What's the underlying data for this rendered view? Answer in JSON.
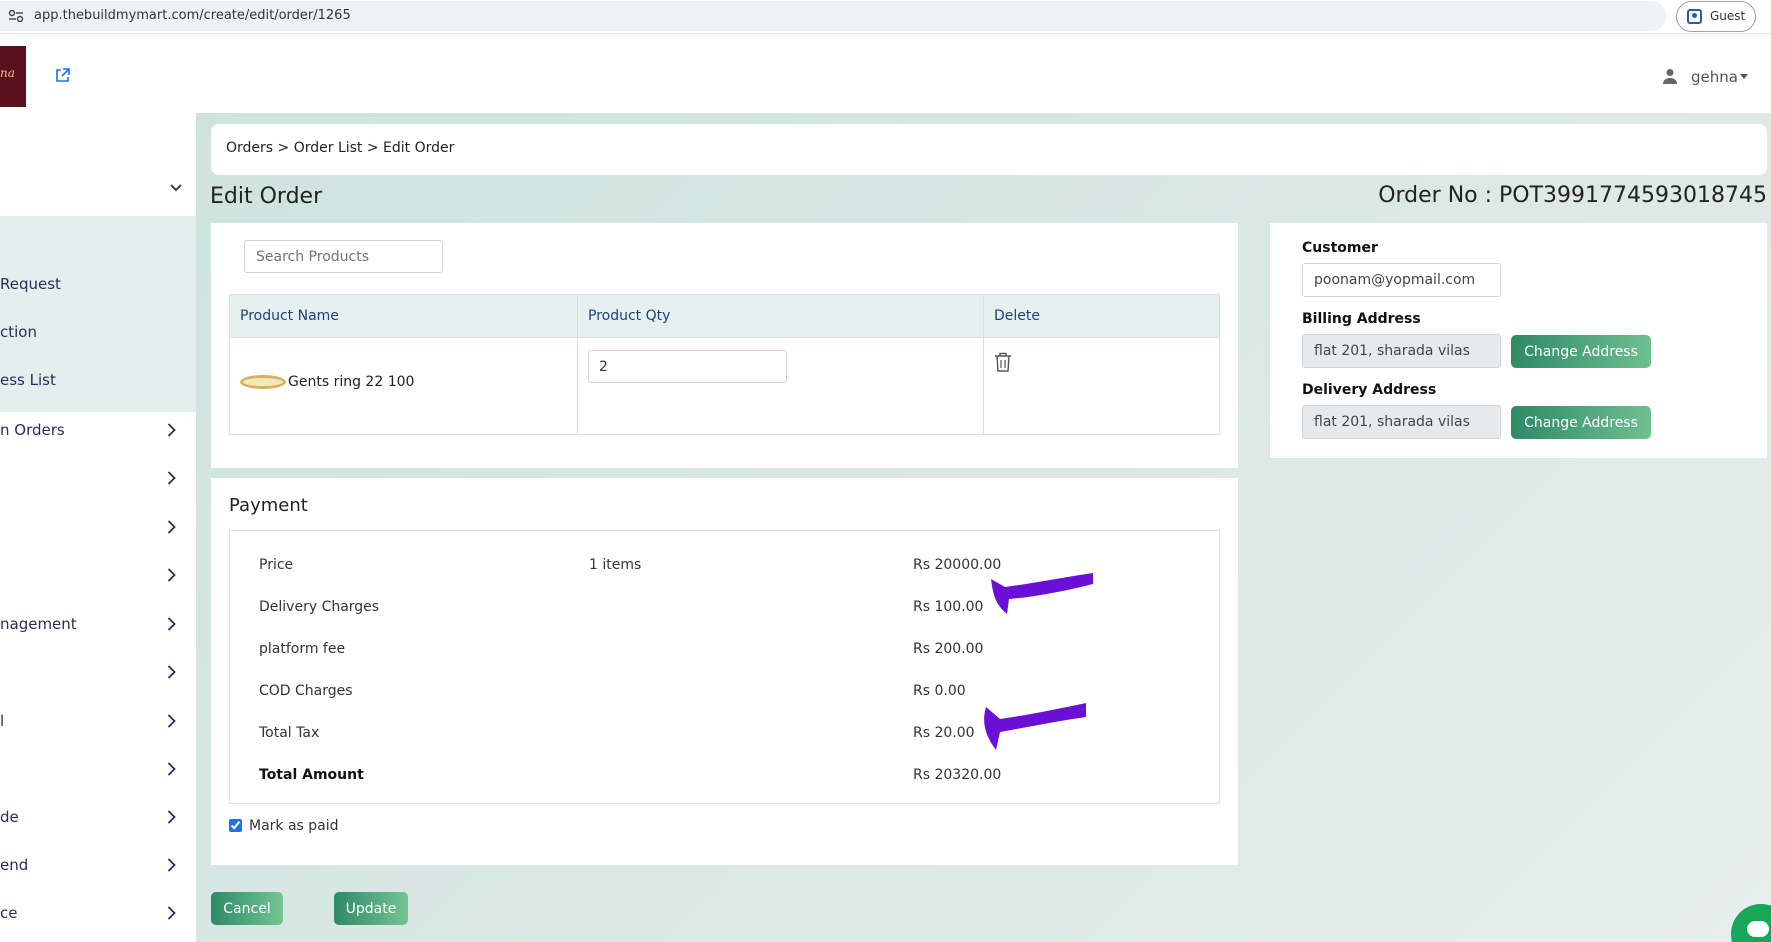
{
  "browser": {
    "url": "app.thebuildmymart.com/create/edit/order/1265",
    "profile_label": "Guest"
  },
  "header": {
    "logo_text": "na",
    "user_name": "gehna"
  },
  "sidebar": {
    "items": [
      {
        "label": "Request",
        "has_chevron": false
      },
      {
        "label": "ction",
        "has_chevron": false
      },
      {
        "label": "ess List",
        "has_chevron": false
      },
      {
        "label": "n Orders",
        "has_chevron": true
      },
      {
        "label": "",
        "has_chevron": true
      },
      {
        "label": "",
        "has_chevron": true
      },
      {
        "label": "",
        "has_chevron": true
      },
      {
        "label": "nagement",
        "has_chevron": true
      },
      {
        "label": "",
        "has_chevron": true
      },
      {
        "label": "l",
        "has_chevron": true
      },
      {
        "label": "",
        "has_chevron": true
      },
      {
        "label": "de",
        "has_chevron": true
      },
      {
        "label": "end",
        "has_chevron": true
      },
      {
        "label": "ce",
        "has_chevron": true
      }
    ]
  },
  "breadcrumb": "Orders > Order List > Edit Order",
  "page": {
    "title": "Edit Order",
    "order_no": "Order No : POT3991774593018745"
  },
  "products": {
    "search_placeholder": "Search Products",
    "columns": [
      "Product Name",
      "Product Qty",
      "Delete"
    ],
    "rows": [
      {
        "name": "Gents ring 22 100",
        "qty": "2"
      }
    ]
  },
  "customer": {
    "customer_label": "Customer",
    "customer_value": "poonam@yopmail.com",
    "billing_label": "Billing Address",
    "billing_value": "flat 201, sharada vilas",
    "delivery_label": "Delivery Address",
    "delivery_value": "flat 201, sharada vilas",
    "change_address_label": "Change Address"
  },
  "payment": {
    "title": "Payment",
    "rows": [
      {
        "label": "Price",
        "mid": "1 items",
        "amount": "Rs 20000.00"
      },
      {
        "label": "Delivery Charges",
        "mid": "",
        "amount": "Rs 100.00"
      },
      {
        "label": "platform fee",
        "mid": "",
        "amount": "Rs 200.00"
      },
      {
        "label": "COD Charges",
        "mid": "",
        "amount": "Rs 0.00"
      },
      {
        "label": "Total Tax",
        "mid": "",
        "amount": "Rs 20.00"
      },
      {
        "label": "Total Amount",
        "mid": "",
        "amount": "Rs 20320.00"
      }
    ],
    "mark_paid_label": "Mark as paid",
    "mark_paid_checked": true
  },
  "actions": {
    "cancel_label": "Cancel",
    "update_label": "Update"
  },
  "colors": {
    "accent_green": "#2e8a68",
    "annotation_purple": "#6a0fd6",
    "nav_text": "#2e2a5a"
  }
}
